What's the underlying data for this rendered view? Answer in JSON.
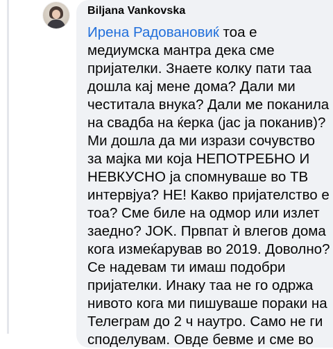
{
  "comment": {
    "author": "Biljana Vankovska",
    "mention": "Ирена Радовановиќ",
    "lines": [
      " тоа е",
      "медиумска мантра дека сме",
      "пријателки. Знаете колку пати таа",
      "дошла кај мене дома? Дали ми",
      "честитала внука? Дали ме поканила",
      "на свадба на ќерка (јас ја поканив)?",
      "Ми дошла да ми изрази сочувство",
      "за мајка ми која НЕПОТРЕБНО И",
      "НЕВКУСНО ја спомнуваше во ТВ",
      "интервјуа? НЕ! Какво пријателство е",
      "тоа? Сме биле на одмор или излет",
      "заедно? JOK. Првпат ѝ влегов дома",
      "кога измеќарував во 2019. Доволно?",
      "Се надевам ти имаш подобри",
      "пријателки. Инаку таа не го одржа",
      "нивото кога ми пишуваше пораки на",
      "Телеграм до 2 ч наутро. Само не ги",
      "споделувам. Овде бевме и сме во"
    ]
  },
  "colors": {
    "mention": "#216fdb",
    "bubble": "#f0f2f5",
    "text": "#050505"
  }
}
